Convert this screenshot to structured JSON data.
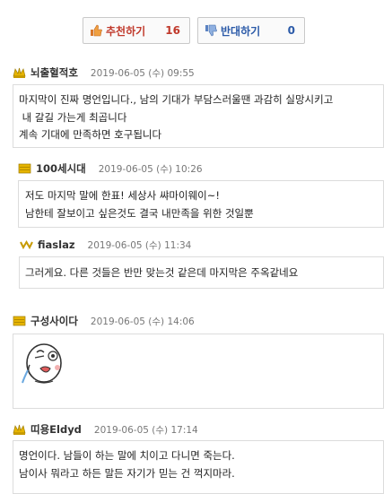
{
  "vote": {
    "up_label": "추천하기",
    "up_count": "16",
    "down_label": "반대하기",
    "down_count": "0"
  },
  "comments": [
    {
      "nick": "뇌출혈적호",
      "date": "2019-06-05 (수) 09:55",
      "lines": [
        "마지막이 진짜 명언입니다., 남의 기대가 부담스러울땐 과감히 실망시키고",
        " 내 갈길 가는게 최곱니다",
        "계속 기대에 만족하면 호구됩니다"
      ]
    },
    {
      "nick": "100세시대",
      "date": "2019-06-05 (수) 10:26",
      "lines": [
        "저도 마지막 말에 한표! 세상사 쌰마이웨이~!",
        "남한테 잘보이고 싶은것도 결국 내만족을 위한 것일뿐"
      ]
    },
    {
      "nick": "fiaslaz",
      "date": "2019-06-05 (수) 11:34",
      "lines": [
        "그러게요. 다른 것들은 반만 맞는것 같은데 마지막은 주옥같네요"
      ]
    },
    {
      "nick": "구성사이다",
      "date": "2019-06-05 (수) 14:06",
      "lines": [],
      "emoticon": "crying-face-emoticon"
    },
    {
      "nick": "띠용Eldyd",
      "date": "2019-06-05 (수) 17:14",
      "lines": [
        "명언이다. 남들이 하는 말에 치이고 다니면 죽는다.",
        "남이사 뭐라고 하든 말든 자기가 믿는 건 꺽지마라."
      ]
    }
  ],
  "icons": {
    "up": "thumbs-up-icon",
    "down": "thumbs-down-icon",
    "level": "member-level-icon"
  }
}
